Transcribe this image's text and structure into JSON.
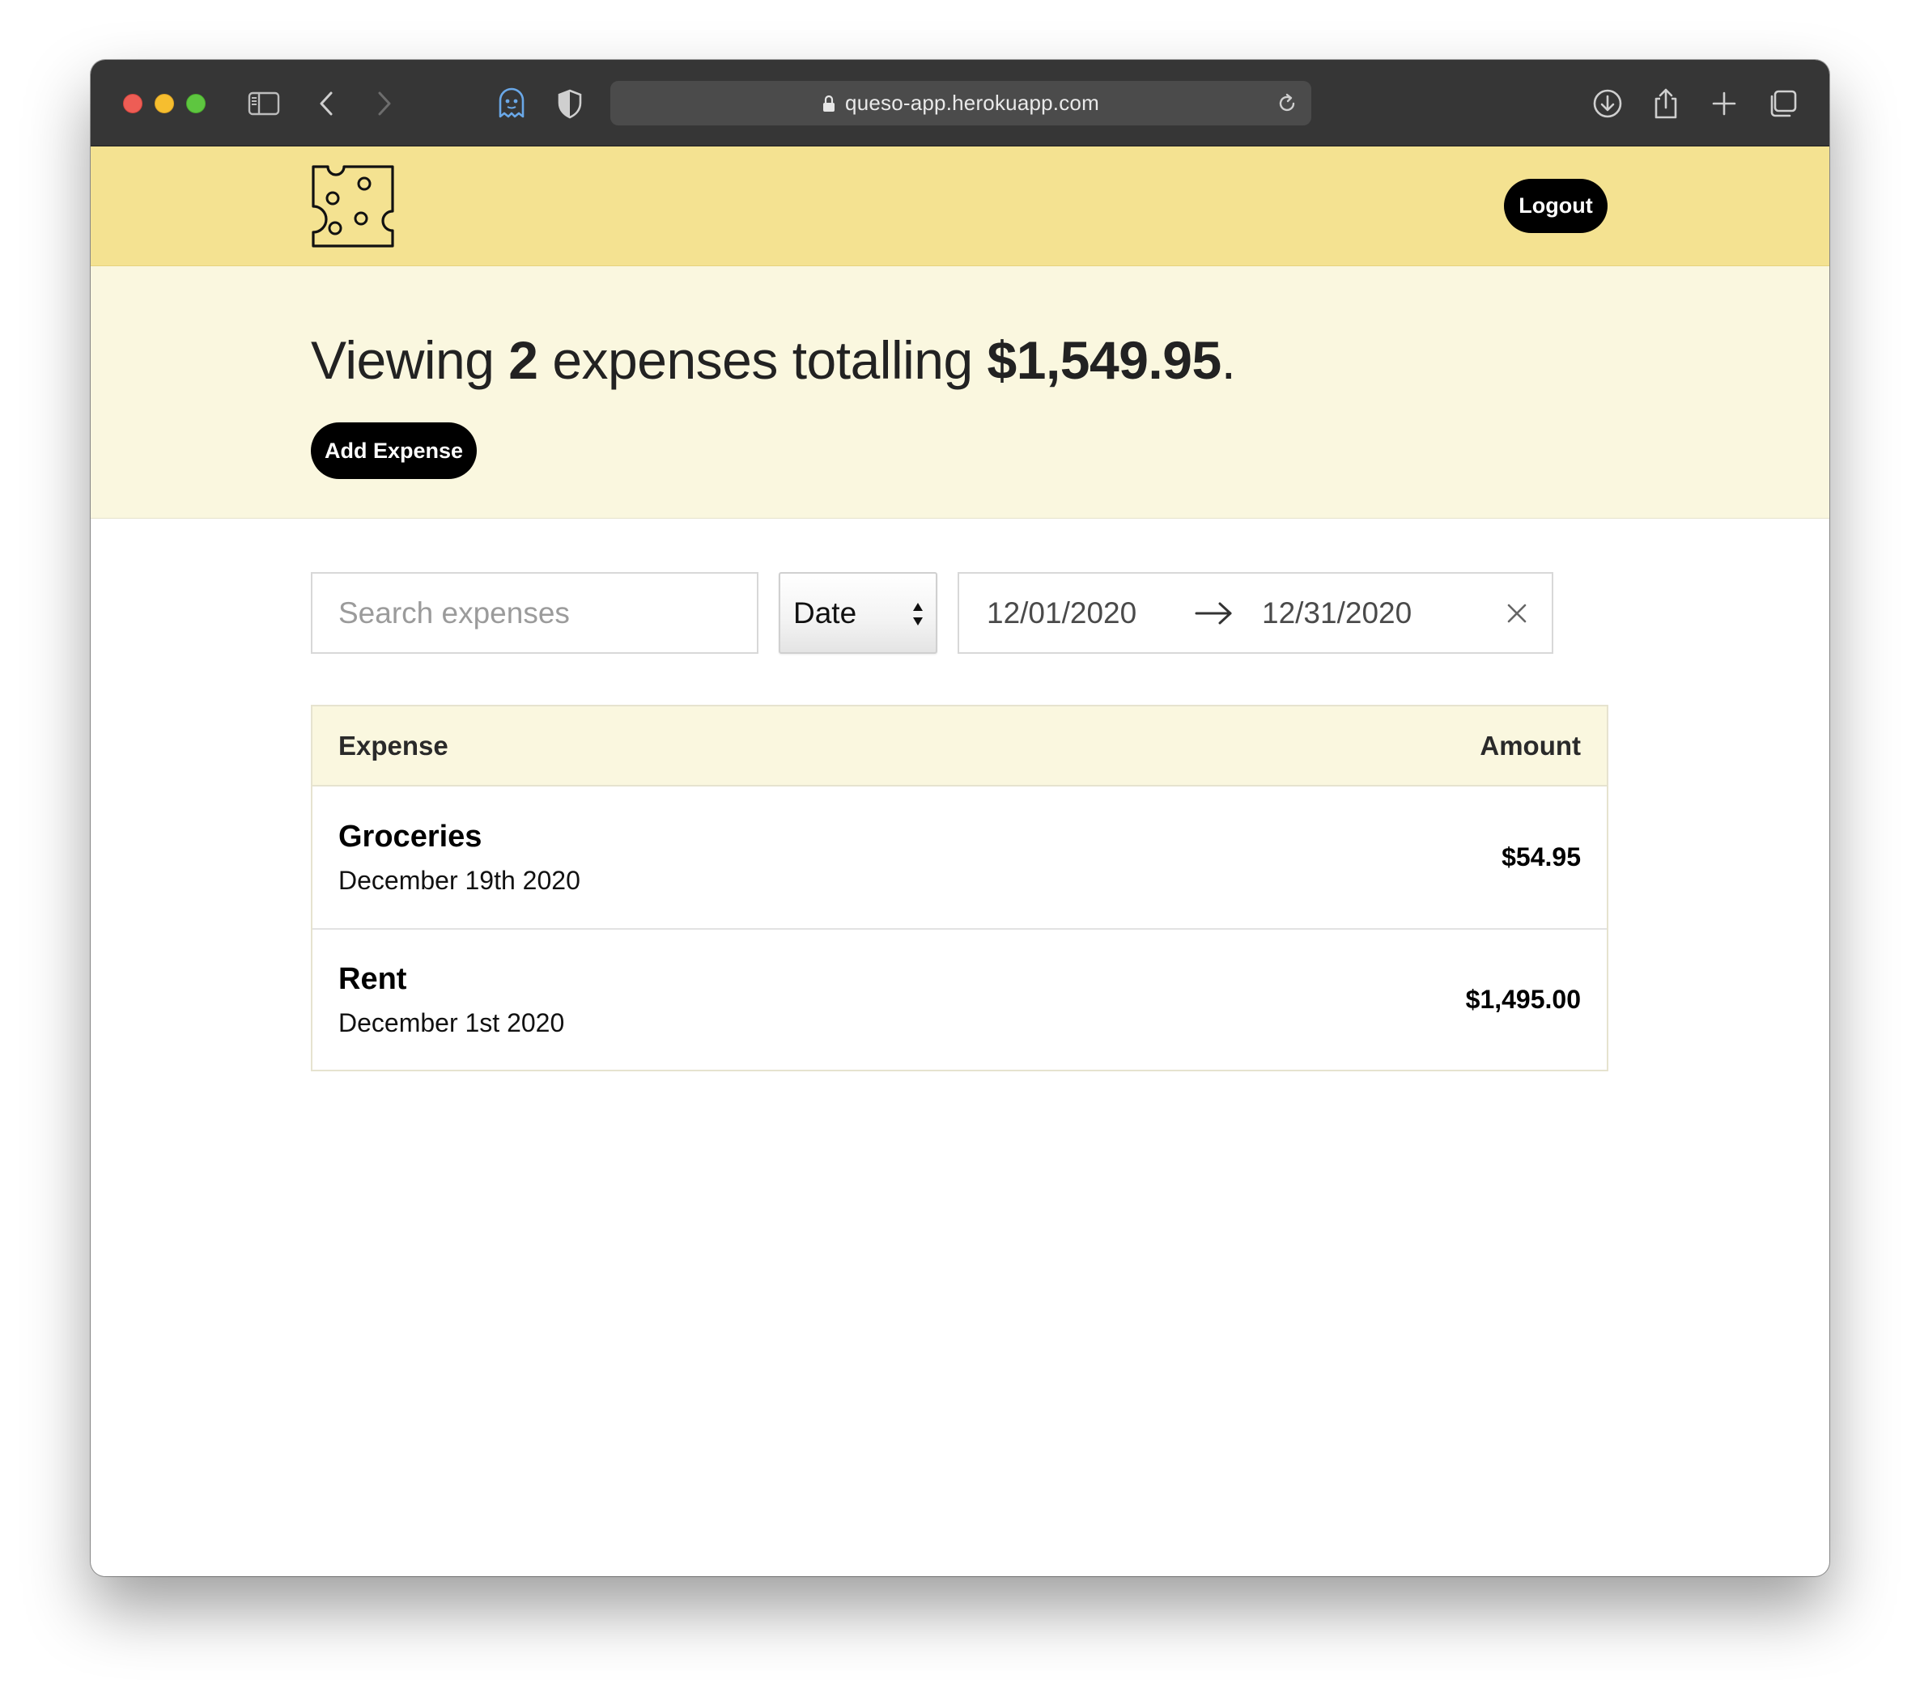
{
  "browser": {
    "url": "queso-app.herokuapp.com",
    "icons": {
      "sidebar": "sidebar-icon",
      "back": "chevron-left-icon",
      "forward": "chevron-right-icon",
      "extension_ghost": "ghost-icon",
      "extension_shield": "shield-icon",
      "lock": "lock-icon",
      "reload": "reload-icon",
      "downloads": "download-icon",
      "share": "share-icon",
      "new_tab": "plus-icon",
      "tabs": "tab-overview-icon"
    }
  },
  "header": {
    "logo": "cheese-logo-icon",
    "logout_label": "Logout",
    "background_color": "#f4e291"
  },
  "summary": {
    "prefix": "Viewing ",
    "count": "2",
    "middle": " expenses totalling ",
    "total": "$1,549.95",
    "suffix": ".",
    "add_expense_label": "Add Expense",
    "background_color": "#faf7df"
  },
  "filters": {
    "search_placeholder": "Search expenses",
    "search_value": "",
    "sort_selected": "Date",
    "date_start": "12/01/2020",
    "date_end": "12/31/2020",
    "arrow_icon": "arrow-right-icon",
    "clear_icon": "close-icon"
  },
  "table": {
    "columns": {
      "expense": "Expense",
      "amount": "Amount"
    },
    "rows": [
      {
        "title": "Groceries",
        "date": "December 19th 2020",
        "amount": "$54.95"
      },
      {
        "title": "Rent",
        "date": "December 1st 2020",
        "amount": "$1,495.00"
      }
    ]
  }
}
